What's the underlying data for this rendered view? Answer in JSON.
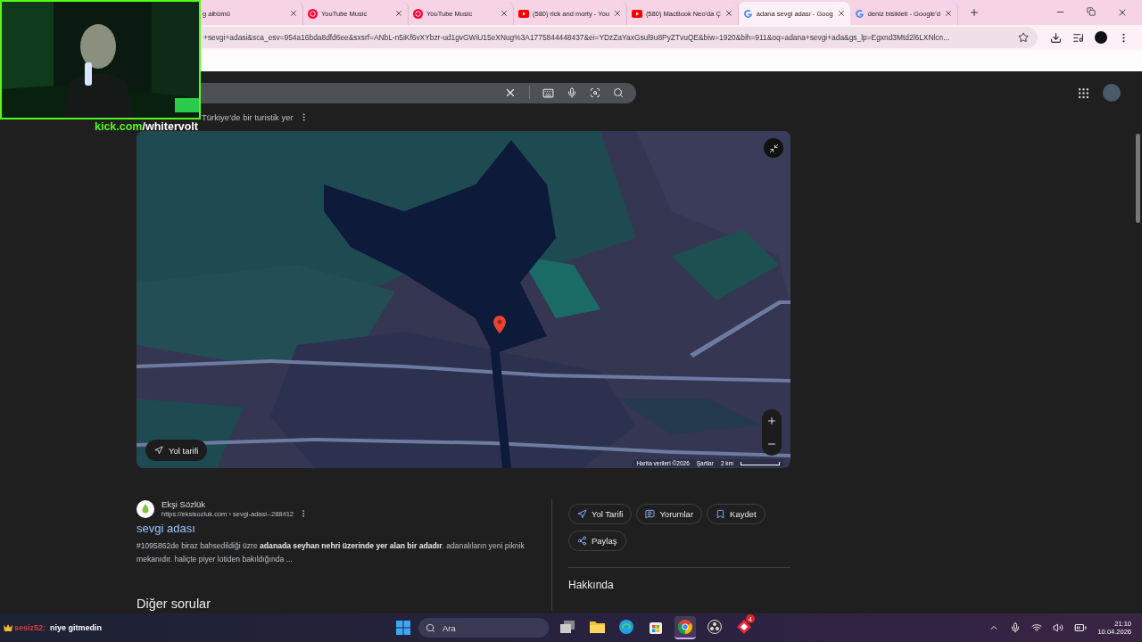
{
  "browser": {
    "tabs": [
      {
        "kind": "none",
        "title": "g albümü",
        "selected": false
      },
      {
        "kind": "music",
        "title": "YouTube Music",
        "selected": false
      },
      {
        "kind": "music",
        "title": "YouTube Music",
        "selected": false
      },
      {
        "kind": "youtube",
        "title": "(580) rick and morty - You",
        "selected": false
      },
      {
        "kind": "youtube",
        "title": "(580) MacBook Neo'da Ç",
        "selected": false
      },
      {
        "kind": "google",
        "title": "adana sevgi adası - Goog",
        "selected": true
      },
      {
        "kind": "google",
        "title": "deniz bisikleti - Google'd",
        "selected": false
      }
    ],
    "address": "+sevgi+adasi&sca_esv=954a16bda8dfd6ee&sxsrf=ANbL-n5iKf6vXYbzr-ud1gvGWiU15eXNug%3A1775844448437&ei=YDzZaYaxGsul9u8PyZTvuQE&biw=1920&bih=911&oq=adana+sevgi+ada&gs_lp=Egxnd3Mtd2l6LXNlcn..."
  },
  "place": {
    "subtitle": "Türkiye'de bir turistik yer"
  },
  "map": {
    "kind": "picture",
    "directions_button": "Yol tarifi",
    "attribution": "Harita verileri ©2026",
    "terms": "Şartlar",
    "scale": "2 km"
  },
  "result": {
    "source": "Ekşi Sözlük",
    "url": "https://eksisozluk.com › sevgi-adasi--288412",
    "title": "sevgi adası",
    "snippet": "#1095862de biraz bahsedildiği üzre **adanada seyhan nehri üzerinde yer alan bir adadır**. adanalıların yeni piknik mekanıdır. haliçte piyer lotiden bakıldığında ..."
  },
  "other_questions": "Diğer sorular",
  "side_actions": [
    {
      "kind": "directions",
      "label": "Yol Tarifi"
    },
    {
      "kind": "reviews",
      "label": "Yorumlar"
    },
    {
      "kind": "save",
      "label": "Kaydet"
    },
    {
      "kind": "share",
      "label": "Paylaş"
    }
  ],
  "about_heading": "Hakkında",
  "stream_overlay": {
    "site": "kick.com",
    "channel": "/whitervolt",
    "chat_user": "sesiz52:",
    "chat_message": "niye gitmedin"
  },
  "taskbar": {
    "search_placeholder": "Ara",
    "apps": [
      {
        "kind": "taskview",
        "selected": false
      },
      {
        "kind": "folder",
        "selected": false
      },
      {
        "kind": "edge",
        "selected": false
      },
      {
        "kind": "store",
        "selected": false
      },
      {
        "kind": "chrome",
        "selected": true
      },
      {
        "kind": "obs",
        "selected": false
      },
      {
        "kind": "red",
        "selected": false,
        "badge": "4"
      }
    ],
    "time": "21:10",
    "date": "10.04.2026"
  }
}
